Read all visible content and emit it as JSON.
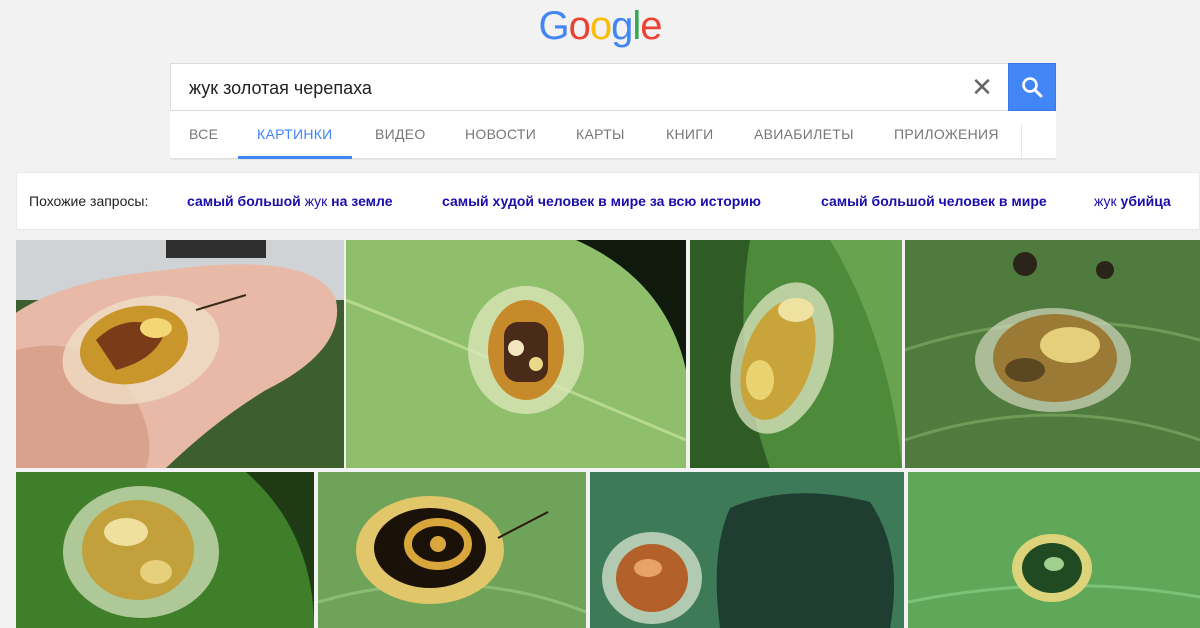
{
  "logo": {
    "letters": [
      {
        "ch": "G",
        "color": "#4285f4"
      },
      {
        "ch": "o",
        "color": "#ea4335"
      },
      {
        "ch": "o",
        "color": "#fbbc05"
      },
      {
        "ch": "g",
        "color": "#4285f4"
      },
      {
        "ch": "l",
        "color": "#34a853"
      },
      {
        "ch": "e",
        "color": "#ea4335"
      }
    ]
  },
  "search": {
    "query": "жук золотая черепаха",
    "clear_icon": "close-icon",
    "submit_icon": "search-icon",
    "accent": "#4285f4"
  },
  "tabs": {
    "items": [
      "Все",
      "Картинки",
      "Видео",
      "Новости",
      "Карты",
      "Книги",
      "Авиабилеты",
      "Приложения"
    ],
    "active_index": 1
  },
  "related": {
    "label": "Похожие запросы:",
    "items": [
      {
        "bold_a": "самый большой",
        "light": "жук",
        "bold_b": "на земле"
      },
      {
        "bold_a": "самый худой человек в мире за всю историю",
        "light": "",
        "bold_b": ""
      },
      {
        "bold_a": "самый большой человек в мире",
        "light": "",
        "bold_b": ""
      },
      {
        "bold_a": "",
        "light": "жук",
        "bold_b": "убийца"
      }
    ]
  }
}
